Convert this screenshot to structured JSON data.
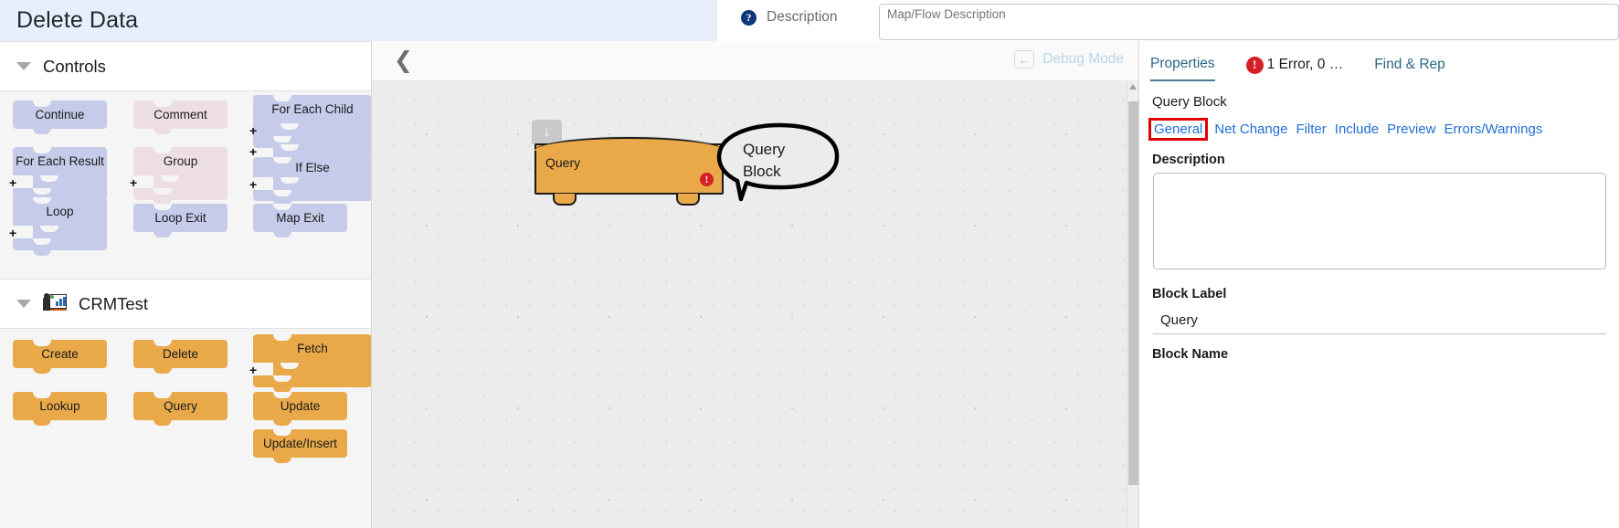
{
  "header": {
    "map_title": "Delete Data",
    "description_label": "Description",
    "help_icon": "help-circle-icon",
    "description_placeholder": "Map/Flow Description",
    "description_value": ""
  },
  "palette": {
    "sections": [
      {
        "title": "Controls",
        "caret": "caret-down-icon",
        "icon": null,
        "blocks": [
          {
            "label": "Continue",
            "kind": "simple",
            "color": "purple"
          },
          {
            "label": "Comment",
            "kind": "simple",
            "color": "pink"
          },
          {
            "label": "For Each Child",
            "kind": "container",
            "color": "purple"
          },
          {
            "label": "For Each Result",
            "kind": "container",
            "color": "purple"
          },
          {
            "label": "Group",
            "kind": "container",
            "color": "pink"
          },
          {
            "label": "If Else",
            "kind": "container2",
            "color": "purple"
          },
          {
            "label": "Loop",
            "kind": "container",
            "color": "purple"
          },
          {
            "label": "Loop Exit",
            "kind": "simple",
            "color": "purple"
          },
          {
            "label": "Map Exit",
            "kind": "simple",
            "color": "purple"
          }
        ]
      },
      {
        "title": "CRMTest",
        "caret": "caret-down-icon",
        "icon": "crm-presenter-icon",
        "blocks": [
          {
            "label": "Create",
            "kind": "simple",
            "color": "orange"
          },
          {
            "label": "Delete",
            "kind": "simple",
            "color": "orange"
          },
          {
            "label": "Fetch",
            "kind": "container",
            "color": "orange"
          },
          {
            "label": "Lookup",
            "kind": "simple",
            "color": "orange"
          },
          {
            "label": "Query",
            "kind": "simple",
            "color": "orange"
          },
          {
            "label": "Update",
            "kind": "simple",
            "color": "orange"
          },
          {
            "label": "Update/Insert",
            "kind": "simple",
            "color": "orange"
          }
        ]
      }
    ]
  },
  "canvas": {
    "collapse_icon": "chevron-left-icon",
    "debug_mode_label": "Debug Mode",
    "debug_arrow_icon": "arrow-left-icon",
    "node": {
      "label": "Query",
      "error_icon": "error-exclamation-icon",
      "drag_handle_icon": "arrow-down-icon"
    },
    "annotation": {
      "line1": "Query",
      "line2": "Block"
    }
  },
  "properties": {
    "tabs": [
      {
        "label": "Properties",
        "active": true,
        "icon": null
      },
      {
        "label": "1 Error, 0 …",
        "active": false,
        "icon": "error-exclamation-icon"
      },
      {
        "label": "Find & Rep",
        "active": false,
        "icon": null
      }
    ],
    "block_kind": "Query Block",
    "subtabs": [
      {
        "label": "General",
        "highlighted": true
      },
      {
        "label": "Net Change",
        "highlighted": false
      },
      {
        "label": "Filter",
        "highlighted": false
      },
      {
        "label": "Include",
        "highlighted": false
      },
      {
        "label": "Preview",
        "highlighted": false
      },
      {
        "label": "Errors/Warnings",
        "highlighted": false
      }
    ],
    "description_label": "Description",
    "description_value": "",
    "block_label_label": "Block Label",
    "block_label_value": "Query",
    "block_name_label": "Block Name",
    "block_name_value": ""
  },
  "colors": {
    "header_bg": "#e8eefb",
    "purple_block": "#c5cbe9",
    "pink_block": "#eddee1",
    "orange_block": "#e9a949",
    "error_red": "#d62027",
    "link_blue": "#1f6fd4",
    "highlight_red": "#e00000"
  }
}
